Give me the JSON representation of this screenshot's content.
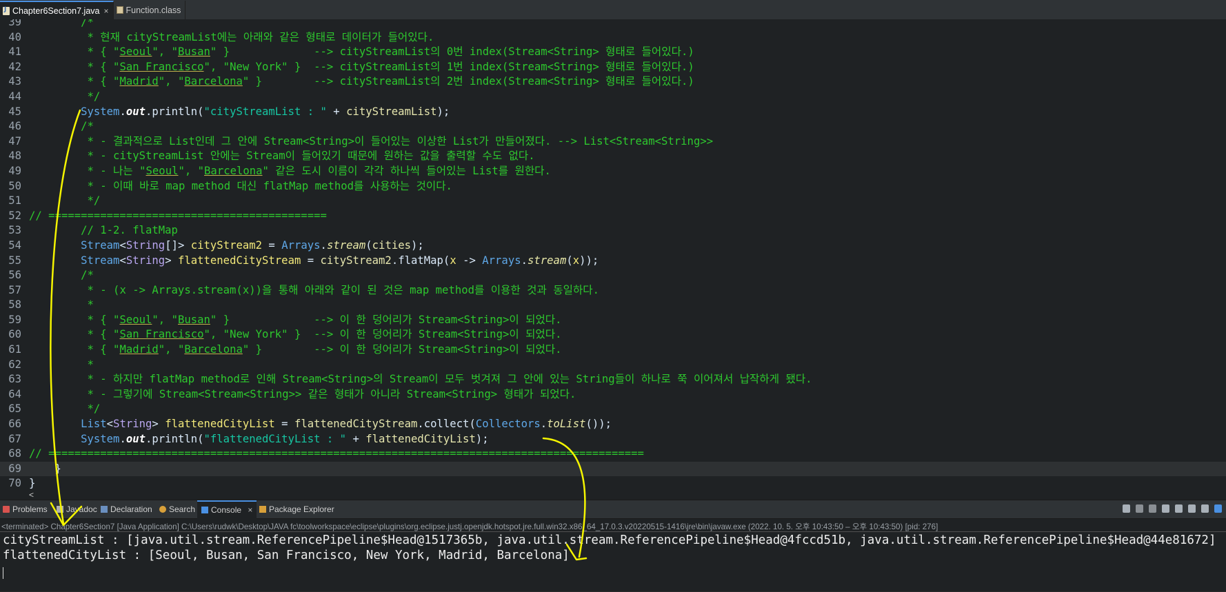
{
  "editor_tabs": [
    {
      "label": "Chapter6Section7.java",
      "close": "×",
      "active": true
    },
    {
      "label": "Function.class",
      "active": false
    }
  ],
  "code_lines": [
    {
      "num": "39",
      "html": "        <span class='c'>/*</span>"
    },
    {
      "num": "40",
      "html": "         <span class='c'>* 현재 cityStreamList에는 아래와 같은 형태로 데이터가 들어있다.</span>"
    },
    {
      "num": "41",
      "html": "         <span class='c'>* { \"<span class='u'>Seoul</span>\", \"<span class='u'>Busan</span>\" }             --&gt; cityStreamList의 0번 index(Stream&lt;String&gt; 형태로 들어있다.)</span>"
    },
    {
      "num": "42",
      "html": "         <span class='c'>* { \"<span class='u'>San Francisco</span>\", \"New York\" }  --&gt; cityStreamList의 1번 index(Stream&lt;String&gt; 형태로 들어있다.)</span>"
    },
    {
      "num": "43",
      "html": "         <span class='c'>* { \"<span class='u'>Madrid</span>\", \"<span class='u'>Barcelona</span>\" }        --&gt; cityStreamList의 2번 index(Stream&lt;String&gt; 형태로 들어있다.)</span>"
    },
    {
      "num": "44",
      "html": "         <span class='c'>*/</span>"
    },
    {
      "num": "45",
      "html": "        <span class='cls'>System</span>.<span class='fd'>out</span>.println(<span class='st'>\"cityStreamList : \"</span> + <span class='vb'>cityStreamList</span>);"
    },
    {
      "num": "46",
      "html": "        <span class='c'>/*</span>"
    },
    {
      "num": "47",
      "html": "         <span class='c'>* - 결과적으로 List인데 그 안에 Stream&lt;String&gt;이 들어있는 이상한 List가 만들어졌다. --&gt; List&lt;Stream&lt;String&gt;&gt;</span>"
    },
    {
      "num": "48",
      "html": "         <span class='c'>* - cityStreamList 안에는 Stream이 들어있기 때문에 원하는 값을 출력할 수도 없다.</span>"
    },
    {
      "num": "49",
      "html": "         <span class='c'>* - 나는 \"<span class='u'>Seoul</span>\", \"<span class='u'>Barcelona</span>\" 같은 도시 이름이 각각 하나씩 들어있는 List를 원한다.</span>"
    },
    {
      "num": "50",
      "html": "         <span class='c'>* - 이때 바로 map method 대신 flatMap method를 사용하는 것이다.</span>"
    },
    {
      "num": "51",
      "html": "         <span class='c'>*/</span>"
    },
    {
      "num": "52",
      "html": "<span class='c'>// ===========================================</span>"
    },
    {
      "num": "53",
      "html": "        <span class='c'>// 1-2. flatMap</span>"
    },
    {
      "num": "54",
      "html": "        <span class='cls'>Stream</span>&lt;<span class='t'>String</span>[]&gt; <span class='v'>cityStream2</span> = <span class='cls'>Arrays</span>.<span class='sm'>stream</span>(<span class='vb'>cities</span>);"
    },
    {
      "num": "55",
      "html": "        <span class='cls'>Stream</span>&lt;<span class='t'>String</span>&gt; <span class='v'>flattenedCityStream</span> = <span class='vb'>cityStream2</span>.flatMap(<span class='v'>x</span> -&gt; <span class='cls'>Arrays</span>.<span class='sm'>stream</span>(<span class='v'>x</span>));"
    },
    {
      "num": "56",
      "html": "        <span class='c'>/*</span>"
    },
    {
      "num": "57",
      "html": "         <span class='c'>* - (x -&gt; Arrays.stream(x))을 통해 아래와 같이 된 것은 map method를 이용한 것과 동일하다.</span>"
    },
    {
      "num": "58",
      "html": "         <span class='c'>*</span>"
    },
    {
      "num": "59",
      "html": "         <span class='c'>* { \"<span class='u'>Seoul</span>\", \"<span class='u'>Busan</span>\" }             --&gt; 이 한 덩어리가 Stream&lt;String&gt;이 되었다.</span>"
    },
    {
      "num": "60",
      "html": "         <span class='c'>* { \"<span class='u'>San Francisco</span>\", \"New York\" }  --&gt; 이 한 덩어리가 Stream&lt;String&gt;이 되었다.</span>"
    },
    {
      "num": "61",
      "html": "         <span class='c'>* { \"<span class='u'>Madrid</span>\", \"<span class='u'>Barcelona</span>\" }        --&gt; 이 한 덩어리가 Stream&lt;String&gt;이 되었다.</span>"
    },
    {
      "num": "62",
      "html": "         <span class='c'>*</span>"
    },
    {
      "num": "63",
      "html": "         <span class='c'>* - 하지만 flatMap method로 인해 Stream&lt;String&gt;의 Stream이 모두 벗겨져 그 안에 있는 String들이 하나로 쭉 이어져서 납작하게 됐다.</span>"
    },
    {
      "num": "64",
      "html": "         <span class='c'>* - 그렇기에 Stream&lt;Stream&lt;String&gt;&gt; 같은 형태가 아니라 Stream&lt;String&gt; 형태가 되었다.</span>"
    },
    {
      "num": "65",
      "html": "         <span class='c'>*/</span>"
    },
    {
      "num": "66",
      "html": "        <span class='cls'>List</span>&lt;<span class='t'>String</span>&gt; <span class='v'>flattenedCityList</span> = <span class='vb'>flattenedCityStream</span>.collect(<span class='cls'>Collectors</span>.<span class='sm'>toList</span>());"
    },
    {
      "num": "67",
      "html": "        <span class='cls'>System</span>.<span class='fd'>out</span>.println(<span class='st'>\"flattenedCityList : \"</span> + <span class='vb'>flattenedCityList</span>);"
    },
    {
      "num": "68",
      "html": "<span class='c'>// ============================================================================================</span>"
    },
    {
      "num": "69",
      "html": "    }",
      "highlight": true
    },
    {
      "num": "70",
      "html": "}"
    }
  ],
  "editor_scroll_marker": "<",
  "view_tabs": [
    {
      "label": "Problems",
      "color": "#d9534f"
    },
    {
      "label": "Javadoc",
      "color": "#b0b0b0"
    },
    {
      "label": "Declaration",
      "color": "#6a8fbf"
    },
    {
      "label": "Search",
      "color": "#d8a03a"
    },
    {
      "label": "Console",
      "color": "#4a90e2",
      "active": true,
      "close": "×"
    },
    {
      "label": "Package Explorer",
      "color": "#d8a03a"
    }
  ],
  "console": {
    "terminated_line": "<terminated> Chapter6Section7 [Java Application] C:\\Users\\rudwk\\Desktop\\JAVA fc\\toolworkspace\\eclipse\\plugins\\org.eclipse.justj.openjdk.hotspot.jre.full.win32.x86_64_17.0.3.v20220515-1416\\jre\\bin\\javaw.exe  (2022. 10. 5. 오후 10:43:50 – 오후 10:43:50) [pid: 276]",
    "output": [
      "cityStreamList : [java.util.stream.ReferencePipeline$Head@1517365b, java.util.stream.ReferencePipeline$Head@4fccd51b, java.util.stream.ReferencePipeline$Head@44e81672]",
      "flattenedCityList : [Seoul, Busan, San Francisco, New York, Madrid, Barcelona]"
    ]
  },
  "annotation_color": "#f4f400"
}
